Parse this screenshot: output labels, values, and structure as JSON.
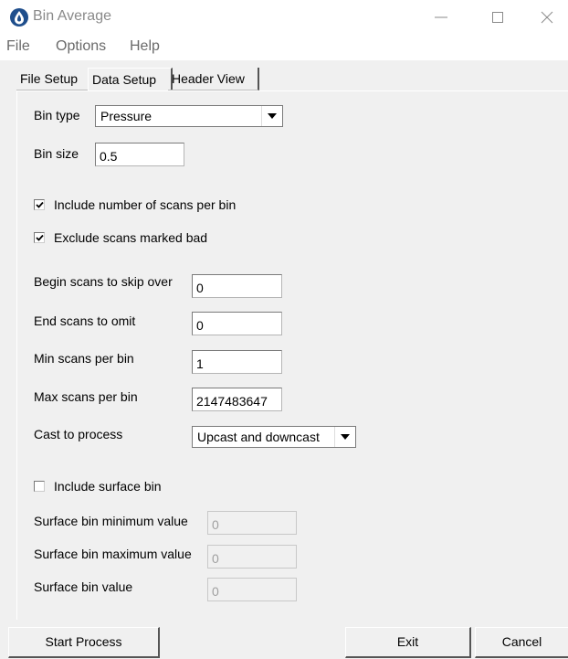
{
  "window": {
    "title": "Bin Average"
  },
  "menu": [
    "File",
    "Options",
    "Help"
  ],
  "tabs": [
    {
      "label": "File Setup",
      "active": false
    },
    {
      "label": "Data Setup",
      "active": true
    },
    {
      "label": "Header View",
      "active": false
    }
  ],
  "form": {
    "bin_type": {
      "label": "Bin type",
      "value": "Pressure"
    },
    "bin_size": {
      "label": "Bin size",
      "value": "0.5"
    },
    "include_scans": {
      "label": "Include number of scans per bin",
      "checked": true
    },
    "exclude_bad": {
      "label": "Exclude scans marked bad",
      "checked": true
    },
    "begin_skip": {
      "label": "Begin scans to skip over",
      "value": "0"
    },
    "end_omit": {
      "label": "End scans to omit",
      "value": "0"
    },
    "min_scans": {
      "label": "Min scans per bin",
      "value": "1"
    },
    "max_scans": {
      "label": "Max scans per bin",
      "value": "2147483647"
    },
    "cast": {
      "label": "Cast to process",
      "value": "Upcast and downcast"
    },
    "include_surface": {
      "label": "Include surface bin",
      "checked": false
    },
    "surface_min": {
      "label": "Surface bin minimum value",
      "value": "0"
    },
    "surface_max": {
      "label": "Surface bin maximum value",
      "value": "0"
    },
    "surface_value": {
      "label": "Surface bin value",
      "value": "0"
    }
  },
  "buttons": {
    "start": "Start Process",
    "exit": "Exit",
    "cancel": "Cancel"
  },
  "colors": {
    "app_icon": "#1f4e8c",
    "disabled_text": "#a0a0a0",
    "window_bg": "#f0f0f0"
  },
  "icons": {
    "app": "water-drop-icon",
    "minimize": "minimize-icon",
    "maximize": "maximize-icon",
    "close": "close-icon",
    "dropdown": "chevron-down-icon",
    "check": "check-icon"
  }
}
